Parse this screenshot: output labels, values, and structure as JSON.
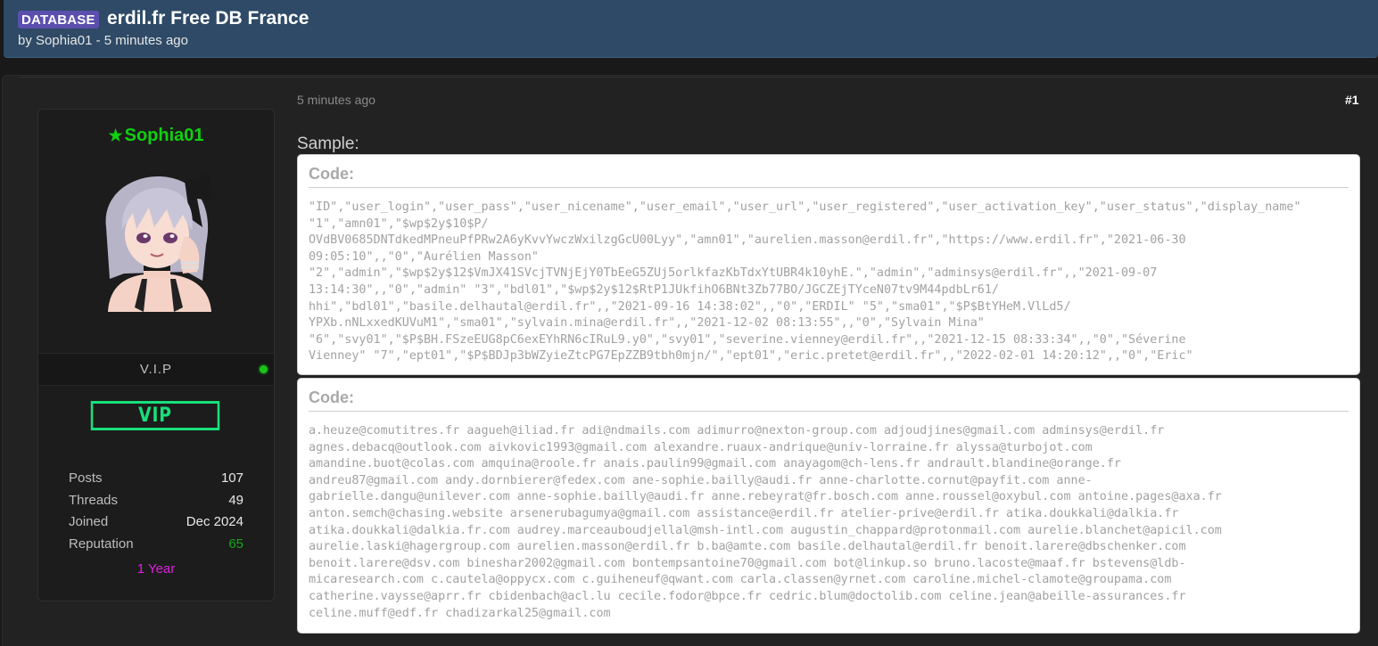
{
  "thread": {
    "prefix": "DATABASE",
    "title": "erdil.fr Free DB France",
    "by_prefix": "by",
    "author": "Sophia01",
    "time": "5 minutes ago"
  },
  "author_panel": {
    "name": "Sophia01",
    "rank": "V.I.P",
    "badge": "VIP",
    "stats": [
      {
        "label": "Posts",
        "value": "107"
      },
      {
        "label": "Threads",
        "value": "49"
      },
      {
        "label": "Joined",
        "value": "Dec 2024"
      },
      {
        "label": "Reputation",
        "value": "65"
      }
    ],
    "tenure": "1 Year"
  },
  "post": {
    "date": "5 minutes ago",
    "number": "#1",
    "sample_label": "Sample:",
    "code_blocks": [
      {
        "header": "Code:",
        "content": "\"ID\",\"user_login\",\"user_pass\",\"user_nicename\",\"user_email\",\"user_url\",\"user_registered\",\"user_activation_key\",\"user_status\",\"display_name\" \"1\",\"amn01\",\"$wp$2y$10$P/\nOVdBV0685DNTdkedMPneuPfPRw2A6yKvvYwczWxilzgGcU00Lyy\",\"amn01\",\"aurelien.masson@erdil.fr\",\"https://www.erdil.fr\",\"2021-06-30\n09:05:10\",,\"0\",\"Aurélien Masson\"\n\"2\",\"admin\",\"$wp$2y$12$VmJX41SVcjTVNjEjY0TbEeG5ZUj5orlkfazKbTdxYtUBR4k10yhE.\",\"admin\",\"adminsys@erdil.fr\",,\"2021-09-07\n13:14:30\",,\"0\",\"admin\" \"3\",\"bdl01\",\"$wp$2y$12$RtP1JUkfihO6BNt3Zb77BO/JGCZEjTYceN07tv9M44pdbLr61/\nhhi\",\"bdl01\",\"basile.delhautal@erdil.fr\",,\"2021-09-16 14:38:02\",,\"0\",\"ERDIL\" \"5\",\"sma01\",\"$P$BtYHeM.VlLd5/\nYPXb.nNLxxedKUVuM1\",\"sma01\",\"sylvain.mina@erdil.fr\",,\"2021-12-02 08:13:55\",,\"0\",\"Sylvain Mina\"\n\"6\",\"svy01\",\"$P$BH.FSzeEUG8pC6exEYhRN6cIRuL9.y0\",\"svy01\",\"severine.vienney@erdil.fr\",,\"2021-12-15 08:33:34\",,\"0\",\"Séverine\nVienney\" \"7\",\"ept01\",\"$P$BDJp3bWZyieZtcPG7EpZZB9tbh0mjn/\",\"ept01\",\"eric.pretet@erdil.fr\",,\"2022-02-01 14:20:12\",,\"0\",\"Eric\""
      },
      {
        "header": "Code:",
        "content": "a.heuze@comutitres.fr aagueh@iliad.fr adi@ndmails.com adimurro@nexton-group.com adjoudjines@gmail.com adminsys@erdil.fr\nagnes.debacq@outlook.com aivkovic1993@gmail.com alexandre.ruaux-andrique@univ-lorraine.fr alyssa@turbojot.com\namandine.buot@colas.com amquina@roole.fr anais.paulin99@gmail.com anayagom@ch-lens.fr andrault.blandine@orange.fr\nandreu87@gmail.com andy.dornbierer@fedex.com ane-sophie.bailly@audi.fr anne-charlotte.cornut@payfit.com anne-\ngabrielle.dangu@unilever.com anne-sophie.bailly@audi.fr anne.rebeyrat@fr.bosch.com anne.roussel@oxybul.com antoine.pages@axa.fr\nanton.semch@chasing.website arsenerubagumya@gmail.com assistance@erdil.fr atelier-prive@erdil.fr atika.doukkali@dalkia.fr\natika.doukkali@dalkia.fr.com audrey.marceauboudjellal@msh-intl.com augustin_chappard@protonmail.com aurelie.blanchet@apicil.com\naurelie.laski@hagergroup.com aurelien.masson@erdil.fr b.ba@amte.com basile.delhautal@erdil.fr benoit.larere@dbschenker.com\nbenoit.larere@dsv.com bineshar2002@gmail.com bontempsantoine70@gmail.com bot@linkup.so bruno.lacoste@maaf.fr bstevens@ldb-\nmicaresearch.com c.cautela@oppycx.com c.guiheneuf@qwant.com carla.classen@yrnet.com caroline.michel-clamote@groupama.com\ncatherine.vaysse@aprr.fr cbidenbach@acl.lu cecile.fodor@bpce.fr cedric.blum@doctolib.com celine.jean@abeille-assurances.fr\nceline.muff@edf.fr chadizarkal25@gmail.com"
      }
    ]
  },
  "colors": {
    "header_bg": "#2e4a66",
    "prefix_bg": "#5b4fae",
    "username": "#0fd00f",
    "vip_badge": "#18e07a",
    "reputation": "#16a916",
    "tenure": "#e020e0"
  }
}
